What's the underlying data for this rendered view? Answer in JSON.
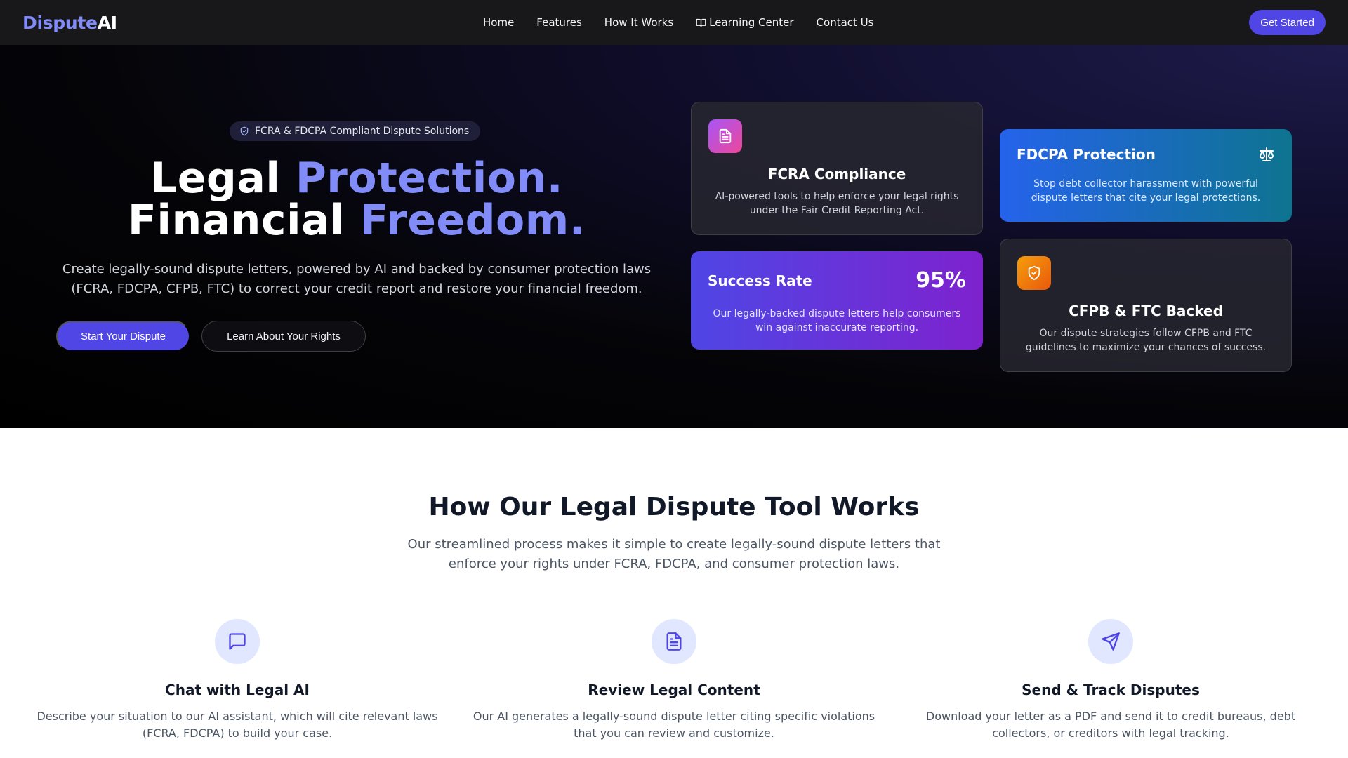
{
  "nav": {
    "logo_part1": "Dispute",
    "logo_part2": "AI",
    "links": [
      "Home",
      "Features",
      "How It Works",
      "Learning Center",
      "Contact Us"
    ],
    "cta": "Get Started"
  },
  "hero": {
    "badge": "FCRA & FDCPA Compliant Dispute Solutions",
    "title_line1_plain": "Legal ",
    "title_line1_highlight": "Protection.",
    "title_line2_plain": "Financial ",
    "title_line2_highlight": "Freedom.",
    "subtitle": "Create legally-sound dispute letters, powered by AI and backed by consumer protection laws (FCRA, FDCPA, CFPB, FTC) to correct your credit report and restore your financial freedom.",
    "primary_button": "Start Your Dispute",
    "secondary_button": "Learn About Your Rights"
  },
  "cards": {
    "fcra": {
      "icon": "document-icon",
      "title": "FCRA Compliance",
      "text": "AI-powered tools to help enforce your legal rights under the Fair Credit Reporting Act."
    },
    "fdcpa": {
      "icon": "scale-icon",
      "title": "FDCPA Protection",
      "text": "Stop debt collector harassment with powerful dispute letters that cite your legal protections."
    },
    "success": {
      "title": "Success Rate",
      "value": "95%",
      "text": "Our legally-backed dispute letters help consumers win against inaccurate reporting."
    },
    "cfpb": {
      "icon": "shield-check-icon",
      "title": "CFPB & FTC Backed",
      "text": "Our dispute strategies follow CFPB and FTC guidelines to maximize your chances of success."
    }
  },
  "how": {
    "title": "How Our Legal Dispute Tool Works",
    "subtitle": "Our streamlined process makes it simple to create legally-sound dispute letters that enforce your rights under FCRA, FDCPA, and consumer protection laws.",
    "steps": [
      {
        "icon": "chat-icon",
        "title": "Chat with Legal AI",
        "text": "Describe your situation to our AI assistant, which will cite relevant laws (FCRA, FDCPA) to build your case."
      },
      {
        "icon": "document-icon",
        "title": "Review Legal Content",
        "text": "Our AI generates a legally-sound dispute letter citing specific violations that you can review and customize."
      },
      {
        "icon": "send-icon",
        "title": "Send & Track Disputes",
        "text": "Download your letter as a PDF and send it to credit bureaus, debt collectors, or creditors with legal tracking."
      }
    ]
  },
  "colors": {
    "accent": "#4f46e5",
    "highlight": "#818cf8",
    "nav_bg": "#18181b"
  }
}
